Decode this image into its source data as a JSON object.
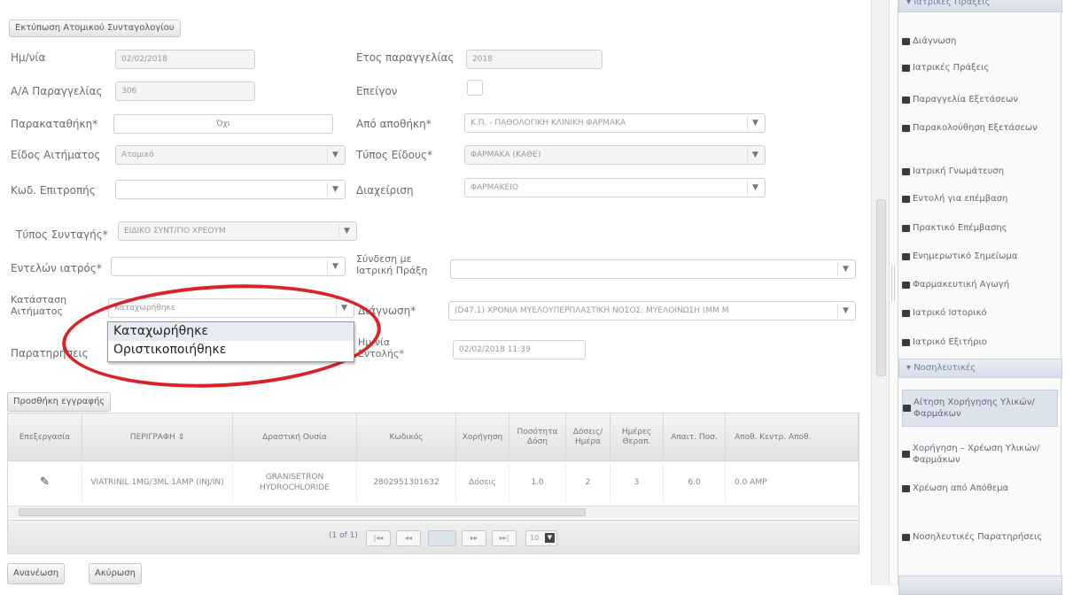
{
  "top_button": "Εκτύπωση Ατομικού Συνταγολογίου",
  "form": {
    "date_label": "Ημ/νία",
    "date_value": "02/02/2018",
    "year_label": "Ετος παραγγελίας",
    "year_value": "2018",
    "order_no_label": "Α/Α Παραγγελίας",
    "order_no_value": "306",
    "urgent_label": "Επείγον",
    "deposit_label": "Παρακαταθήκη*",
    "deposit_value": "Όχι",
    "from_warehouse_label": "Από αποθήκη*",
    "from_warehouse_value": "Κ.Π. - ΠΑΘΟΛΟΓΙΚΗ ΚΛΙΝΙΚΗ ΦΑΡΜΑΚΑ",
    "request_type_label": "Είδος Αιτήματος",
    "request_type_value": "Ατομικό",
    "item_type_label": "Τύπος Είδους*",
    "item_type_value": "ΦΑΡΜΑΚΑ (ΚΑΘΕ)",
    "committee_code_label": "Κωδ. Επιτροπής",
    "committee_code_value": "",
    "management_label": "Διαχείριση",
    "management_value": "ΦΑΡΜΑΚΕΙΟ",
    "prescription_type_label": "Τύπος Συνταγής*",
    "prescription_type_value": "ΕΙΔΙΚΟ ΣΥΝΤ/ΓΙΟ ΧΡΕΟΥΜ",
    "doctor_label": "Εντελών ιατρός*",
    "doctor_value": "",
    "link_label": "Σύνδεση με Ιατρική Πράξη",
    "link_value": "",
    "status_label": "Κατάσταση Αιτήματος",
    "status_value": "Καταχωρήθηκε",
    "diagnosis_label": "Διάγνωση*",
    "diagnosis_value": "(D47.1) ΧΡΟΝΙΑ ΜΥΕΛΟΥΠΕΡΠΛΑΣΤΙΚΗ ΝΟΣΟΣ: ΜΥΕΛΟΙΝΩΣΗ (ΜΜ Μ",
    "notes_label": "Παρατηρήσεις",
    "entry_date_label": "Ημ/νία Εντολής*",
    "entry_date_value": "02/02/2018 11:39"
  },
  "status_dropdown": {
    "options": [
      "Καταχωρήθηκε",
      "Οριστικοποιήθηκε"
    ],
    "selected": 0
  },
  "add_entry_button": "Προσθήκη εγγραφής",
  "table": {
    "headers": [
      "Επεξεργασία",
      "ΠΕΡΙΓΡΑΦΗ ⇕",
      "Δραστική Ουσία",
      "Κωδικός",
      "Χορήγηση",
      "Ποσότητα Δόση",
      "Δόσεις/ Ημέρα",
      "Ημέρες Θεραπ.",
      "Απαιτ. Ποσ.",
      "Αποθ. Κεντρ. Αποθ."
    ],
    "row": [
      "✎",
      "VIATRINIL 1MG/3ML 1AMP (INJ/IN)",
      "GRANISETRON HYDROCHLORIDE",
      "2802951301632",
      "Δόσεις",
      "1.0",
      "2",
      "3",
      "6.0",
      "0.0 AMP"
    ]
  },
  "pager": {
    "page_info": "(1 of 1)",
    "first": "|◂◂",
    "prev": "◂◂",
    "current": "1",
    "next": "▸▸",
    "last": "▸▸|",
    "page_size": "10"
  },
  "bottom_buttons": [
    "Ανανέωση",
    "Ακύρωση"
  ],
  "sidebar": {
    "section1": "Ιατρικές Πράξεις",
    "items1": [
      "Διάγνωση",
      "Ιατρικές Πράξεις",
      "Παραγγελία Εξετάσεων",
      "Παρακολούθηση Εξετάσεων",
      "Ιατρική Γνωμάτευση",
      "Εντολή για επέμβαση",
      "Πρακτικό Επέμβασης",
      "Ενημερωτικό Σημείωμα",
      "Φαρμακευτική Αγωγή",
      "Ιατρικό Ιστορικό",
      "Ιατρικό Εξιτήριο"
    ],
    "section2": "Νοσηλευτικές",
    "items2": [
      "Αίτηση Χορήγησης Υλικών/Φαρμάκων",
      "Χορήγηση – Χρέωση Υλικών/Φαρμάκων",
      "Χρέωση από Απόθεμα",
      "Νοσηλευτικές Παρατηρήσεις"
    ]
  }
}
